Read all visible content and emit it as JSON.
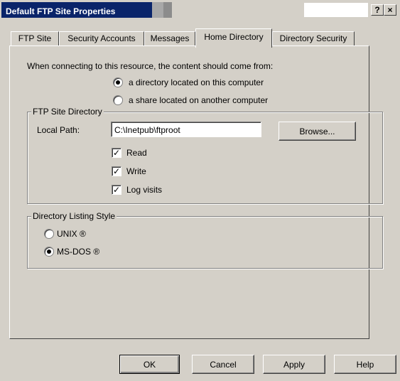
{
  "window": {
    "title": "Default FTP Site Properties",
    "help_button": "?",
    "close_button": "×"
  },
  "tabs": [
    {
      "label": "FTP Site"
    },
    {
      "label": "Security Accounts"
    },
    {
      "label": "Messages"
    },
    {
      "label": "Home Directory"
    },
    {
      "label": "Directory Security"
    }
  ],
  "home_directory": {
    "connect_prompt": "When connecting to this resource, the content should come from:",
    "source_options": [
      {
        "label": "a directory located on this computer",
        "selected": true
      },
      {
        "label": "a share located on another computer",
        "selected": false
      }
    ],
    "ftp_site_directory": {
      "group_label": "FTP Site Directory",
      "local_path_label": "Local Path:",
      "local_path_value": "C:\\Inetpub\\ftproot",
      "browse_label": "Browse...",
      "checks": [
        {
          "label": "Read",
          "checked": true
        },
        {
          "label": "Write",
          "checked": true
        },
        {
          "label": "Log visits",
          "checked": true
        }
      ]
    },
    "listing_style": {
      "group_label": "Directory Listing Style",
      "options": [
        {
          "label": "UNIX ®",
          "selected": false
        },
        {
          "label": "MS-DOS ®",
          "selected": true
        }
      ]
    }
  },
  "footer": {
    "ok": "OK",
    "cancel": "Cancel",
    "apply": "Apply",
    "help": "Help"
  }
}
